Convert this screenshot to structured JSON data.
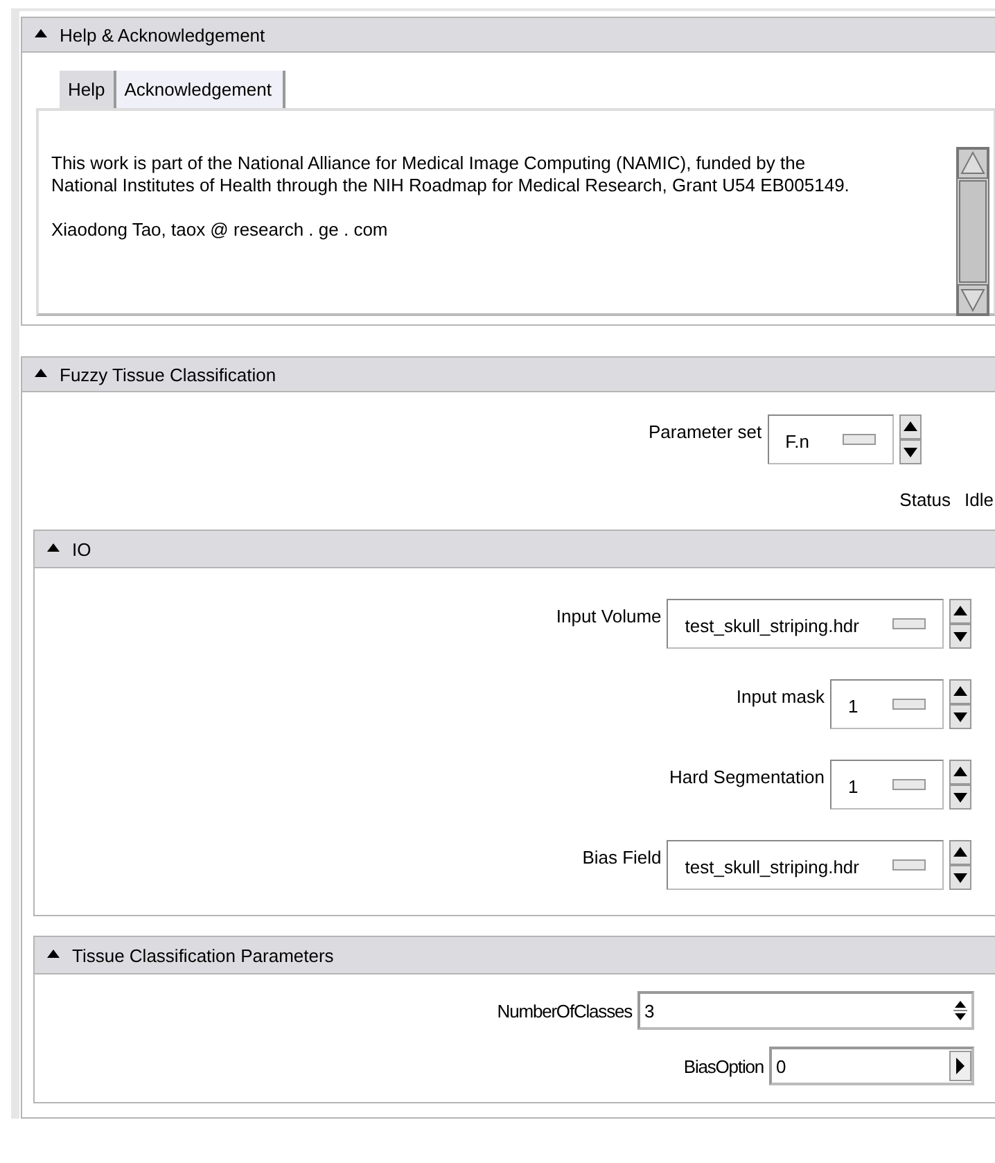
{
  "help_section": {
    "title": "Help & Acknowledgement",
    "expanded": true,
    "tabs": [
      {
        "label": "Help",
        "selected": false
      },
      {
        "label": "Acknowledgement",
        "selected": true
      }
    ],
    "text": [
      "This work is part of the National Alliance for Medical Image Computing (NAMIC), funded by the National Institutes of Health through the NIH Roadmap for Medical Research, Grant U54 EB005149.",
      "Xiaodong Tao, taox @ research . ge . com"
    ]
  },
  "classification_section": {
    "title": "Fuzzy Tissue Classification",
    "expanded": true,
    "parameter_set": {
      "label": "Parameter set",
      "value": "F.n"
    },
    "status": {
      "label": "Status",
      "value": "Idle"
    },
    "subsections": [
      {
        "title": "IO",
        "expanded": true,
        "rows": [
          {
            "kind": "menu",
            "label": "Input Volume",
            "value": "test_skull_striping.hdr"
          },
          {
            "kind": "menu",
            "label": "Input mask",
            "value": "1"
          },
          {
            "kind": "menu",
            "label": "Hard Segmentation",
            "value": "1"
          },
          {
            "kind": "menu",
            "label": "Bias Field",
            "value": "test_skull_striping.hdr"
          }
        ]
      },
      {
        "title": "Tissue Classification Parameters",
        "expanded": true,
        "rows": [
          {
            "kind": "spinbox",
            "label": "NumberOfClasses",
            "value": "3"
          },
          {
            "kind": "arrow_entry",
            "label": "BiasOption",
            "value": "0"
          }
        ]
      }
    ]
  }
}
